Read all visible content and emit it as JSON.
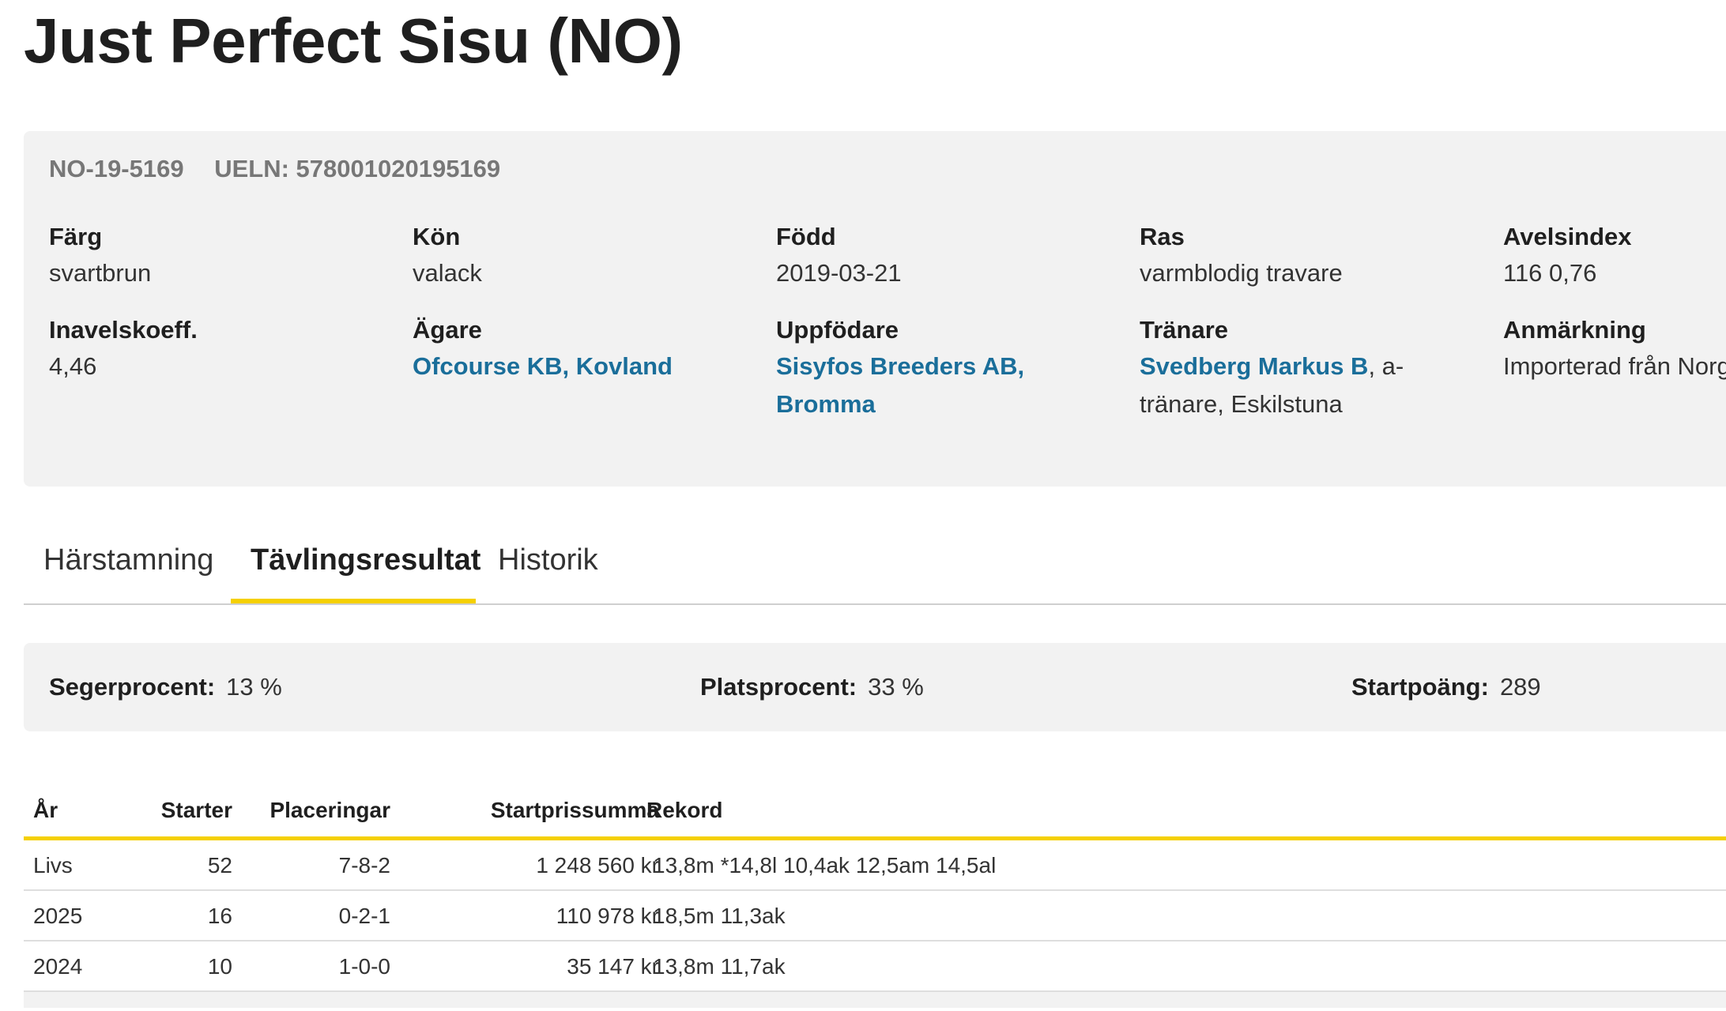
{
  "horse": {
    "title": "Just Perfect Sisu (NO)",
    "reg_number": "NO-19-5169",
    "ueln": "UELN: 578001020195169"
  },
  "fields": {
    "color": {
      "label": "Färg",
      "value": "svartbrun"
    },
    "sex": {
      "label": "Kön",
      "value": "valack"
    },
    "born": {
      "label": "Född",
      "value": "2019-03-21"
    },
    "breed": {
      "label": "Ras",
      "value": "varmblodig travare"
    },
    "breeding_index": {
      "label": "Avelsindex",
      "value": "116 0,76"
    },
    "inbreeding": {
      "label": "Inavelskoeff.",
      "value": "4,46"
    },
    "owner": {
      "label": "Ägare",
      "value": "Ofcourse KB, Kovland"
    },
    "breeder": {
      "label": "Uppfödare",
      "value_line1": "Sisyfos Breeders AB,",
      "value_line2": "Bromma"
    },
    "trainer": {
      "label": "Tränare",
      "link": "Svedberg Markus B",
      "suffix": ", a-",
      "line2": "tränare, Eskilstuna"
    },
    "remark": {
      "label": "Anmärkning",
      "value": "Importerad från Norge"
    }
  },
  "tabs": [
    {
      "label": "Härstamning"
    },
    {
      "label": "Tävlingsresultat",
      "active": true
    },
    {
      "label": "Historik"
    }
  ],
  "stats": {
    "win_label": "Segerprocent:",
    "win_value": "13 %",
    "place_label": "Platsprocent:",
    "place_value": "33 %",
    "points_label": "Startpoäng:",
    "points_value": "289"
  },
  "table": {
    "headers": [
      "År",
      "Starter",
      "Placeringar",
      "Startprissumma",
      "Rekord"
    ],
    "rows": [
      [
        "Livs",
        "52",
        "7-8-2",
        "1 248 560 kr",
        "13,8m *14,8l 10,4ak 12,5am 14,5al"
      ],
      [
        "2025",
        "16",
        "0-2-1",
        "110 978 kr",
        "18,5m 11,3ak"
      ],
      [
        "2024",
        "10",
        "1-0-0",
        "35 147 kr",
        "13,8m 11,7ak"
      ]
    ]
  },
  "colors": {
    "accent_yellow": "#f5d000",
    "link_blue": "#1a6e9a",
    "panel_gray": "#f2f2f2"
  }
}
